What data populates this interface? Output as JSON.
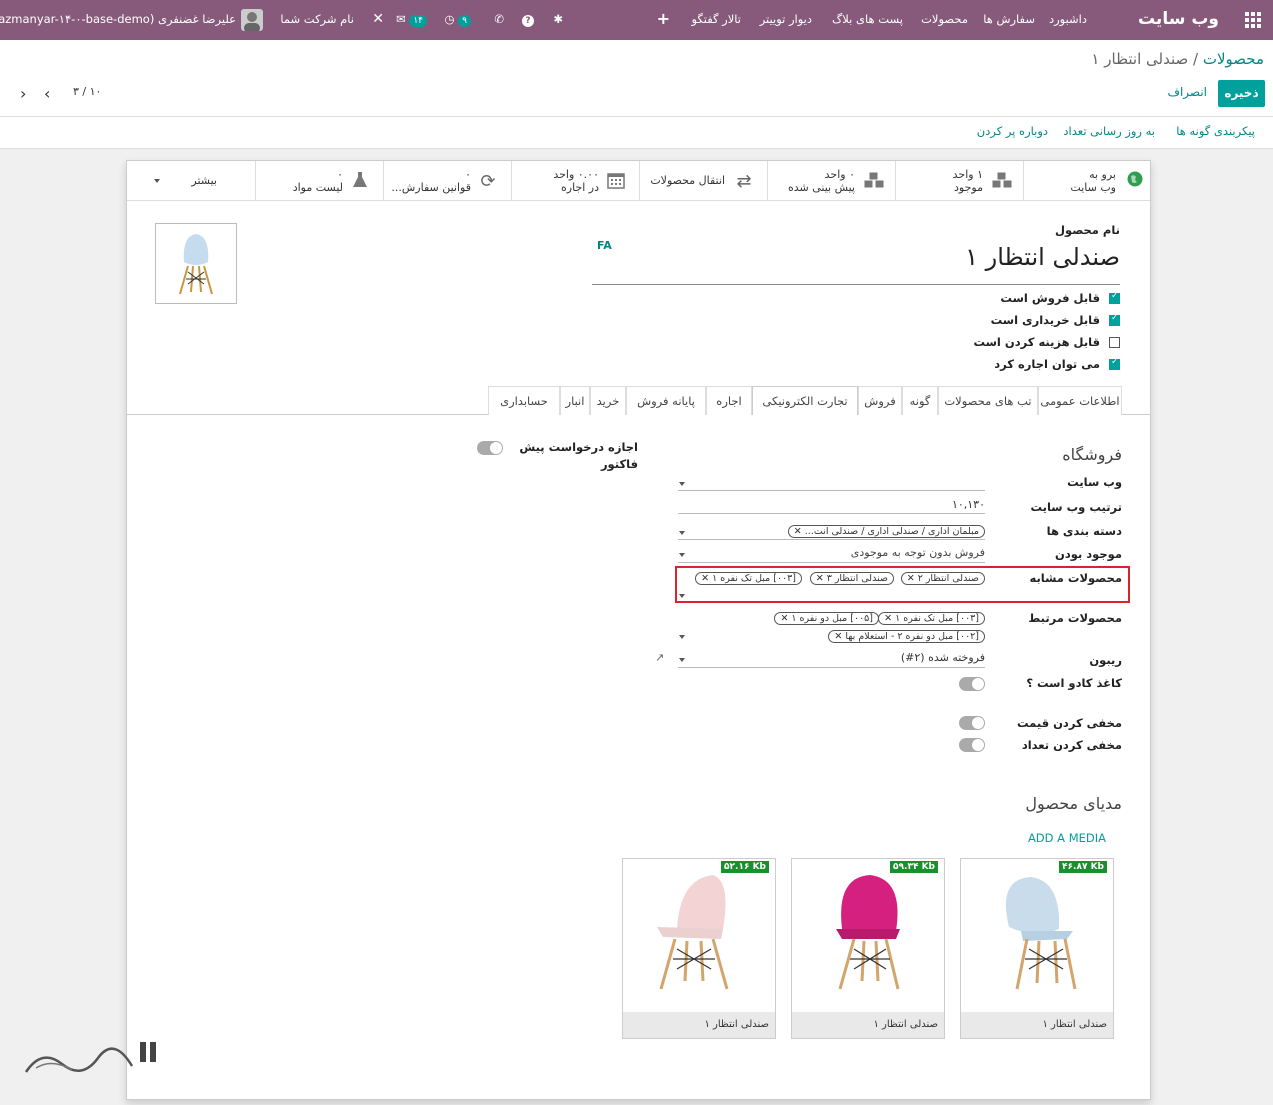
{
  "navbar": {
    "brand": "وب سایت",
    "menu": [
      "داشبورد",
      "سفارش ها",
      "محصولات",
      "پست های بلاگ",
      "دیوار توییتر",
      "تالار گفتگو"
    ],
    "user": "علیرضا غضنفری (sazmanyar-۱۴-۰-base-demo)",
    "company": "نام شرکت شما",
    "messages_count": "۱۴",
    "activity_count": "۹"
  },
  "breadcrumb": {
    "parent": "محصولات",
    "separator": "/",
    "current": "صندلی انتظار ۱"
  },
  "buttons": {
    "save": "ذخیره",
    "discard": "انصراف"
  },
  "pager": {
    "value": "۳ / ۱۰"
  },
  "status_actions": [
    "پیکربندی گونه ها",
    "به روز رسانی تعداد",
    "دوباره پر کردن"
  ],
  "smart_buttons": [
    {
      "line1": "برو به",
      "line2": "وب سایت",
      "icon": "globe-icon"
    },
    {
      "line1": "۱ واحد",
      "line2": "موجود",
      "icon": "cubes-icon"
    },
    {
      "line1": "۰ واحد",
      "line2": "پیش بینی شده",
      "icon": "cubes-icon"
    },
    {
      "line1": "",
      "line2": "انتقال محصولات",
      "icon": "exchange-icon"
    },
    {
      "line1": "۰.۰۰ واحد",
      "line2": "در اجاره",
      "icon": "calendar-icon"
    },
    {
      "line1": "۰",
      "line2": "قوانین سفارش...",
      "icon": "refresh-icon"
    },
    {
      "line1": "۰",
      "line2": "لیست مواد",
      "icon": "flask-icon"
    },
    {
      "line1": "",
      "line2": "بیشتر",
      "icon": "caret-down-icon"
    }
  ],
  "form": {
    "name_label": "نام محصول",
    "name": "صندلی انتظار ۱",
    "lang": "FA",
    "options": [
      {
        "label": "قابل فروش است",
        "checked": true
      },
      {
        "label": "قابل خریداری است",
        "checked": true
      },
      {
        "label": "قابل هزینه کردن است",
        "checked": false
      },
      {
        "label": "می توان اجاره کرد",
        "checked": true
      }
    ]
  },
  "tabs": [
    "اطلاعات عمومی",
    "تب های محصولات",
    "گونه",
    "فروش",
    "تجارت الکترونیکی",
    "اجاره",
    "پایانه فروش",
    "خرید",
    "انبار",
    "حسابداری"
  ],
  "ecommerce": {
    "shop_title": "فروشگاه",
    "website_label": "وب سایت",
    "sequence_label": "ترتیب وب سایت",
    "sequence_value": "۱۰,۱۳۰",
    "category_label": "دسته بندی ها",
    "category_tag": "مبلمان اداری / صندلی اداری / صندلی انت...",
    "availability_label": "موجود بودن",
    "availability_value": "فروش بدون توجه به موجودی",
    "alternative_label": "محصولات مشابه",
    "alternative_tags": [
      "صندلی انتظار ۲",
      "صندلی انتظار ۳",
      "[۰۰۳] مبل تک نفره ۱"
    ],
    "accessory_label": "محصولات مرتبط",
    "accessory_tags": [
      "[۰۰۳] مبل تک نفره ۱",
      "[۰۰۵] مبل دو نفره ۱",
      "[۰۰۲] مبل دو نفره ۲ - استعلام بها"
    ],
    "ribbon_label": "ریبون",
    "ribbon_value": "فروخته شده (۲#)",
    "gift_label": "کاغذ کادو است ؟",
    "hide_price_label": "مخفی کردن قیمت",
    "hide_qty_label": "مخفی کردن تعداد",
    "quote_label_1": "اجازه درخواست پیش",
    "quote_label_2": "فاکتور",
    "media_title": "مدیای محصول",
    "add_media": "ADD A MEDIA",
    "media": [
      {
        "caption": "صندلی انتظار ۱",
        "size": "۴۶.۸۷ Kb",
        "color": "#c9dceb"
      },
      {
        "caption": "صندلی انتظار ۱",
        "size": "۵۹.۳۴ Kb",
        "color": "#d6207f"
      },
      {
        "caption": "صندلی انتظار ۱",
        "size": "۵۲.۱۶ Kb",
        "color": "#f3d3d3"
      }
    ]
  },
  "colors": {
    "navbar": "#875a7b",
    "primary": "#00a09d",
    "highlight": "#d9232d"
  }
}
